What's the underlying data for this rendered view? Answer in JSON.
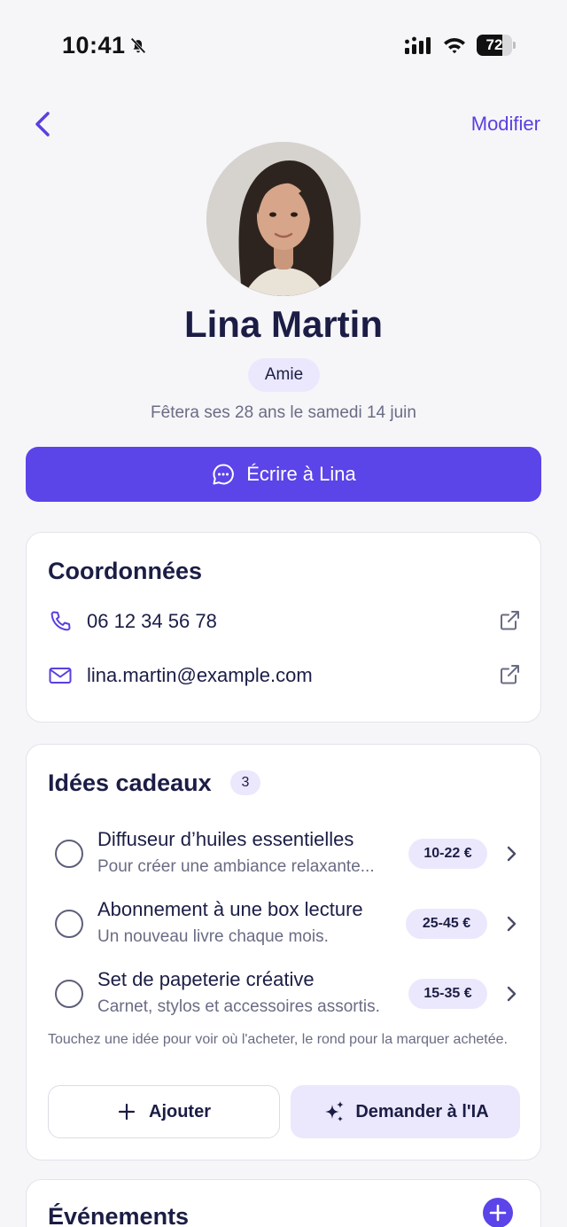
{
  "status_bar": {
    "time": "10:41",
    "battery_percent": 72,
    "battery_label": "72",
    "icons": [
      "bell-off-icon",
      "signal-icon",
      "wifi-icon",
      "battery-icon"
    ]
  },
  "nav": {
    "back_icon": "chevron-left-icon",
    "edit_label": "Modifier"
  },
  "profile": {
    "name": "Lina Martin",
    "relation": "Amie",
    "birthday_text": "Fêtera ses 28 ans le samedi 14 juin"
  },
  "write_button": {
    "label": "Écrire à Lina",
    "icon": "chat-bubble-icon"
  },
  "contact": {
    "title": "Coordonnées",
    "phone": "06 12 34 56 78",
    "email": "lina.martin@example.com"
  },
  "gifts": {
    "title": "Idées cadeaux",
    "count": "3",
    "items": [
      {
        "title": "Diffuseur d’huiles essentielles",
        "subtitle": "Pour créer une ambiance relaxante...",
        "price": "10-22 €",
        "checked": false
      },
      {
        "title": "Abonnement à une box lecture",
        "subtitle": "Un nouveau livre chaque mois.",
        "price": "25-45 €",
        "checked": false
      },
      {
        "title": "Set de papeterie créative",
        "subtitle": "Carnet, stylos et accessoires assortis.",
        "price": "15-35 €",
        "checked": false
      }
    ],
    "hint": "Touchez une idée pour voir où l'acheter, le rond pour la marquer achetée.",
    "add_label": "Ajouter",
    "ai_label": "Demander à l'IA"
  },
  "events": {
    "title": "Événements"
  },
  "colors": {
    "accent": "#5b44e8",
    "accent_soft": "#ebe8fd",
    "text_primary": "#1b1d45",
    "text_secondary": "#6a6c84",
    "background": "#f6f6f9"
  }
}
